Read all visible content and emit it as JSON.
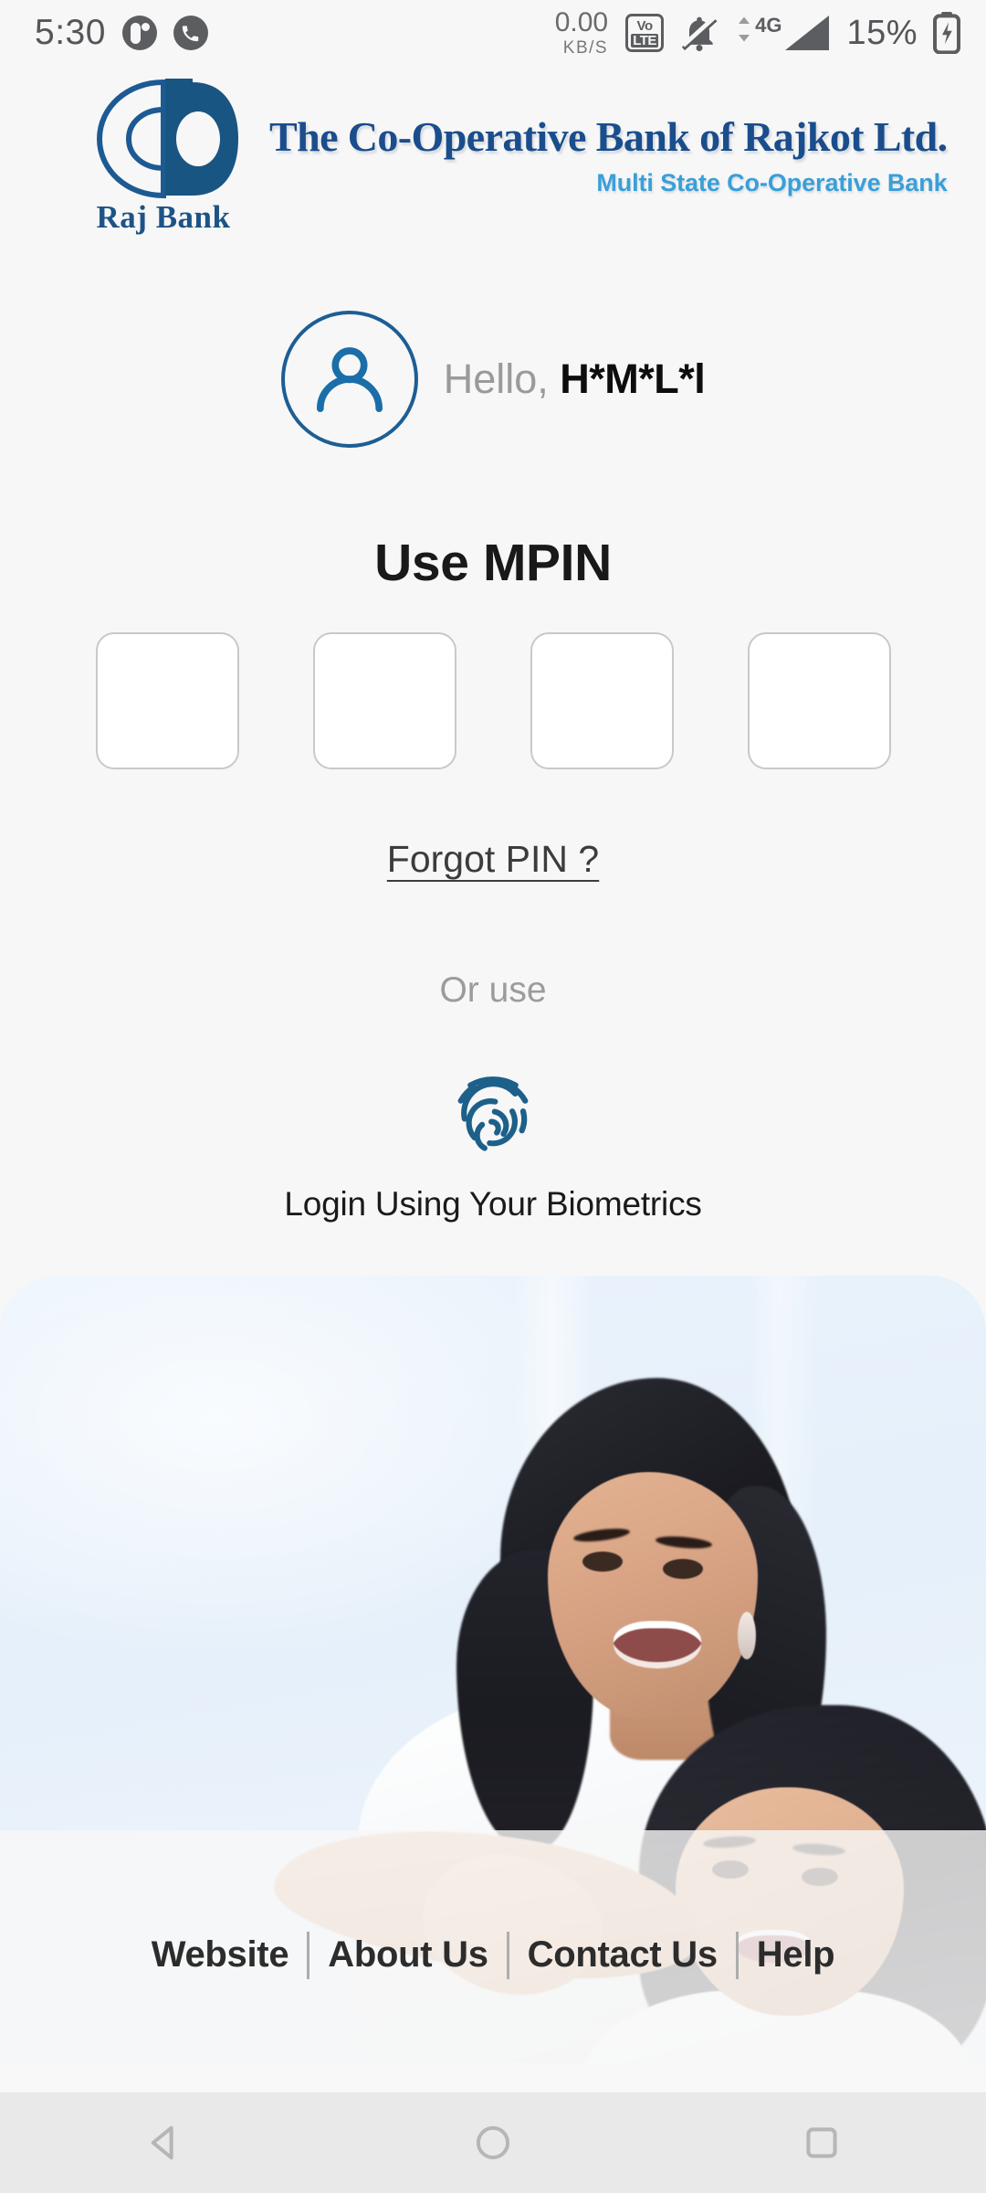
{
  "status_bar": {
    "clock": "5:30",
    "network_speed_value": "0.00",
    "network_speed_unit": "KB/S",
    "volte_top": "Vo",
    "volte_bottom": "LTE",
    "network_type": "4G",
    "battery_percent": "15%",
    "icons": [
      "app-notification-icon",
      "phone-call-icon",
      "volte-icon",
      "bell-muted-icon",
      "data-arrows-icon",
      "signal-bars-icon",
      "battery-charging-icon"
    ]
  },
  "header": {
    "logo_label": "Raj Bank",
    "bank_name": "The Co-Operative Bank of Rajkot Ltd.",
    "tagline": "Multi State Co-Operative Bank",
    "brand_dark_blue": "#1a4d8c",
    "brand_light_blue": "#3a9fd8"
  },
  "greeting": {
    "hello": "Hello,",
    "username": "H*M*L*l",
    "avatar_icon": "person-icon"
  },
  "mpin": {
    "title": "Use MPIN",
    "boxes": [
      "",
      "",
      "",
      ""
    ],
    "box_count": 4,
    "forgot_link": "Forgot PIN ?"
  },
  "biometrics": {
    "or_use": "Or use",
    "icon": "fingerprint-icon",
    "label": "Login Using Your Biometrics",
    "icon_color": "#1d6089"
  },
  "hero_image": {
    "alt": "Smiling mother hugging her young daughter, both in white, light blue background",
    "background_color": "#e9f2fb"
  },
  "footer": {
    "links": [
      {
        "label": "Website"
      },
      {
        "label": "About Us"
      },
      {
        "label": "Contact Us"
      },
      {
        "label": "Help"
      }
    ]
  },
  "nav_bar": {
    "back": "back-icon",
    "home": "home-icon",
    "recents": "recents-icon"
  }
}
